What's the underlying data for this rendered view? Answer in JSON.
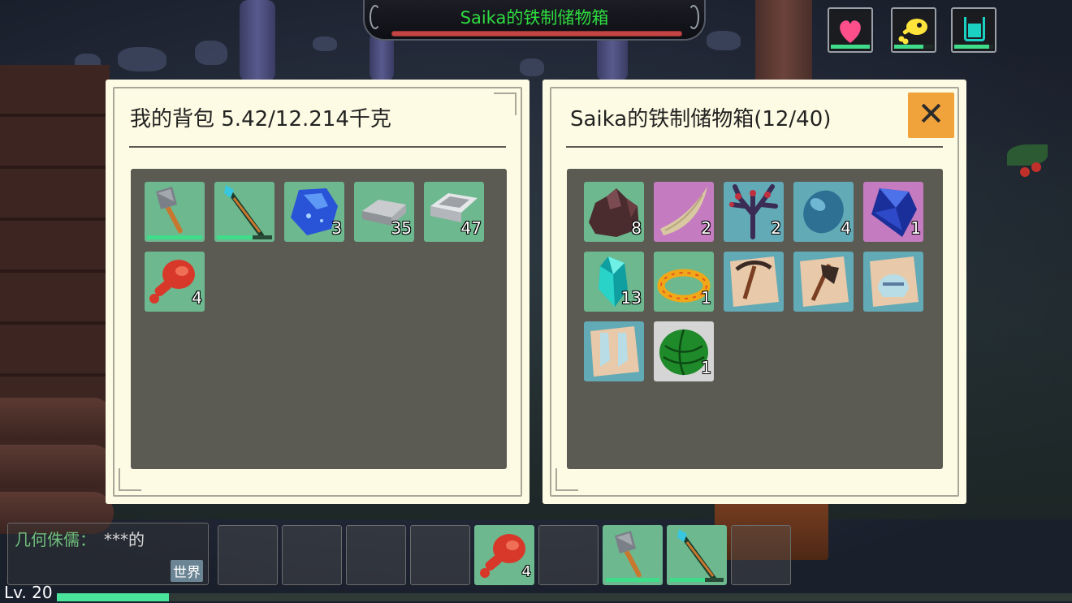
{
  "container_title": "Saika的铁制储物箱",
  "container_hp_fraction": 1.0,
  "status": {
    "health": {
      "icon": "heart-icon",
      "color": "#ff4f8b",
      "fraction": 1.0
    },
    "hunger": {
      "icon": "meat-icon",
      "color": "#ffe53b",
      "fraction": 0.75
    },
    "thirst": {
      "icon": "water-cup-icon",
      "color": "#1bd1c2",
      "fraction": 0.9
    }
  },
  "backpack": {
    "title": "我的背包  5.42/12.214千克",
    "items": [
      {
        "name": "stone-axe",
        "icon": "axe-icon",
        "count": null,
        "durability": 1.0,
        "bg": "green"
      },
      {
        "name": "crystal-spear",
        "icon": "spear-icon",
        "count": null,
        "durability": 0.65,
        "bg": "green"
      },
      {
        "name": "blue-gem-ore",
        "icon": "blue-ore-icon",
        "count": "3",
        "durability": null,
        "bg": "green"
      },
      {
        "name": "iron-ingot",
        "icon": "iron-ingot-icon",
        "count": "35",
        "durability": null,
        "bg": "green"
      },
      {
        "name": "silver-ingot",
        "icon": "silver-ingot-icon",
        "count": "47",
        "durability": null,
        "bg": "green"
      },
      {
        "name": "roast-meat",
        "icon": "meat-leg-icon",
        "count": "4",
        "durability": null,
        "bg": "green"
      }
    ]
  },
  "chest": {
    "title": "Saika的铁制储物箱(12/40)",
    "close_label": "✕",
    "items": [
      {
        "name": "dark-ore",
        "icon": "dark-ore-icon",
        "count": "8",
        "bg": "green"
      },
      {
        "name": "bone-horn",
        "icon": "horn-icon",
        "count": "2",
        "bg": "purple"
      },
      {
        "name": "coral",
        "icon": "coral-icon",
        "count": "2",
        "bg": "teal"
      },
      {
        "name": "blue-egg-stone",
        "icon": "blue-stone-icon",
        "count": "4",
        "bg": "teal"
      },
      {
        "name": "sapphire",
        "icon": "sapphire-icon",
        "count": "1",
        "bg": "purple"
      },
      {
        "name": "cyan-crystal",
        "icon": "cyan-crystal-icon",
        "count": "13",
        "bg": "green"
      },
      {
        "name": "gold-bracelet",
        "icon": "bracelet-icon",
        "count": "1",
        "bg": "green"
      },
      {
        "name": "pickaxe-blueprint",
        "icon": "pickaxe-blueprint-icon",
        "count": null,
        "bg": "teal"
      },
      {
        "name": "axe-blueprint",
        "icon": "axe-blueprint-icon",
        "count": null,
        "bg": "teal"
      },
      {
        "name": "helmet-blueprint",
        "icon": "helmet-blueprint-icon",
        "count": null,
        "bg": "teal"
      },
      {
        "name": "boots-blueprint",
        "icon": "boots-blueprint-icon",
        "count": null,
        "bg": "teal"
      },
      {
        "name": "watermelon",
        "icon": "watermelon-icon",
        "count": "1",
        "bg": "white"
      }
    ]
  },
  "chat": {
    "sender": "几何侏儒：",
    "message": "***的",
    "channel": "世界"
  },
  "hotbar": [
    {
      "icon": null
    },
    {
      "icon": null
    },
    {
      "icon": null
    },
    {
      "icon": null
    },
    {
      "icon": "meat-leg-icon",
      "count": "4"
    },
    {
      "icon": null
    },
    {
      "icon": "axe-icon",
      "durability": 1.0
    },
    {
      "icon": "spear-icon",
      "durability": 0.65
    },
    {
      "icon": null
    }
  ],
  "player": {
    "level": "Lv. 20",
    "xp_fraction": 0.11
  }
}
